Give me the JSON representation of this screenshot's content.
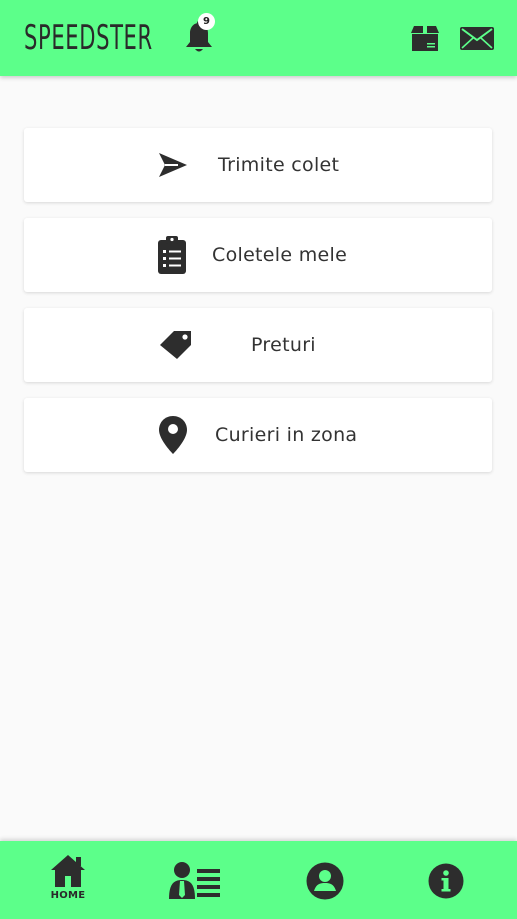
{
  "header": {
    "logo": "SPEEDSTER",
    "notification_count": "9",
    "icons": [
      "bell-icon",
      "package-icon",
      "mail-icon"
    ]
  },
  "menu": {
    "items": [
      {
        "label": "Trimite colet",
        "icon": "paper-plane-icon"
      },
      {
        "label": "Coletele mele",
        "icon": "clipboard-list-icon"
      },
      {
        "label": "Preturi",
        "icon": "price-tag-icon"
      },
      {
        "label": "Curieri in zona",
        "icon": "map-pin-icon"
      }
    ]
  },
  "bottom_nav": {
    "items": [
      {
        "label": "HOME",
        "icon": "home-icon"
      },
      {
        "label": "",
        "icon": "courier-list-icon"
      },
      {
        "label": "",
        "icon": "user-account-icon"
      },
      {
        "label": "",
        "icon": "info-icon"
      }
    ]
  },
  "colors": {
    "accent": "#5cff8a",
    "background": "#fafafa",
    "icon": "#2d2d2d"
  }
}
